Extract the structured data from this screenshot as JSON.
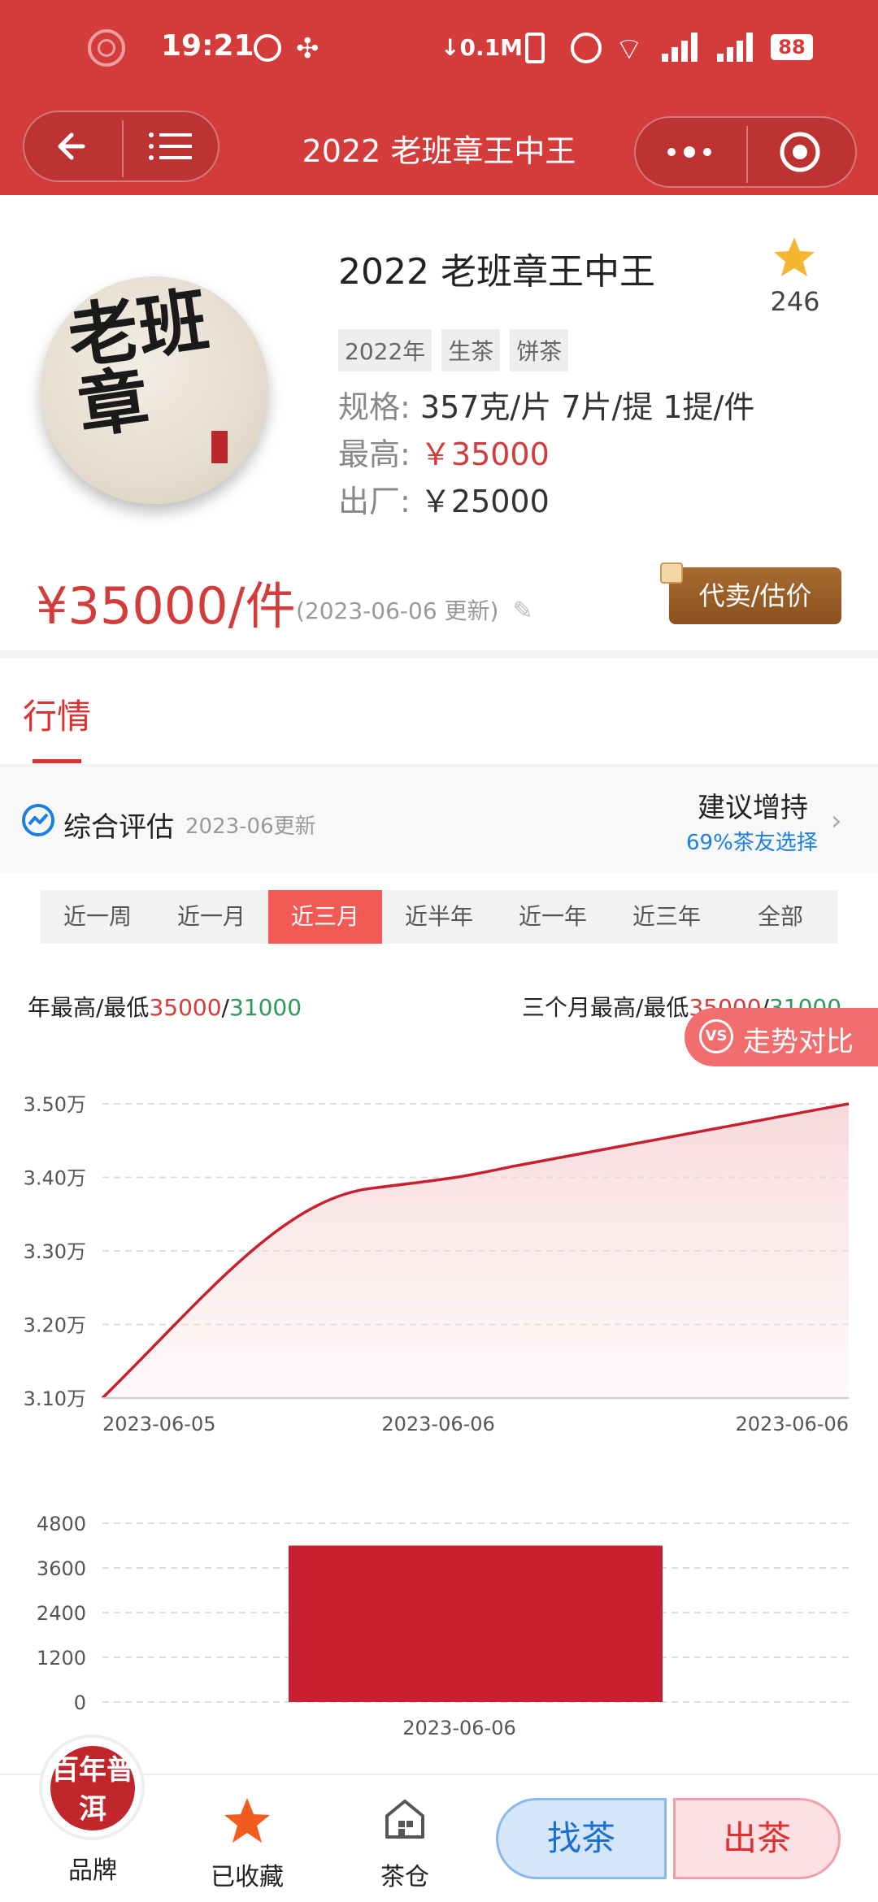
{
  "status_bar": {
    "time": "19:21",
    "net_speed": "↓0.1M",
    "battery": "88"
  },
  "header": {
    "title": "2022 老班章王中王"
  },
  "product": {
    "name": "2022 老班章王中王",
    "favorites_count": "246",
    "tags": [
      "2022年",
      "生茶",
      "饼茶"
    ],
    "spec_label": "规格:",
    "spec_value": "357克/片 7片/提 1提/件",
    "high_label": "最高:",
    "high_value": "￥35000",
    "factory_label": "出厂:",
    "factory_value": "￥25000",
    "image_text": "老班章",
    "price": "¥35000/件",
    "price_note": "(2023-06-06 更新)",
    "consign_button": "代卖/估价"
  },
  "market": {
    "tab_label": "行情",
    "eval_label": "综合评估",
    "eval_date": "2023-06更新",
    "suggest_title": "建议增持",
    "suggest_sub": "69%茶友选择",
    "ranges": [
      "近一周",
      "近一月",
      "近三月",
      "近半年",
      "近一年",
      "近三年",
      "全部"
    ],
    "active_range_index": 2,
    "year_hl_label": "年最高/最低",
    "year_high": "35000",
    "year_low": "31000",
    "q_hl_label": "三个月最高/最低",
    "q_high": "35000",
    "q_low": "31000",
    "compare_button": "走势对比",
    "vs_icon_text": "VS"
  },
  "chart_data": [
    {
      "type": "area",
      "y_tick_labels": [
        "3.50万",
        "3.40万",
        "3.30万",
        "3.20万",
        "3.10万"
      ],
      "y_ticks": [
        35000,
        34000,
        33000,
        32000,
        31000
      ],
      "ylim": [
        31000,
        35000
      ],
      "x_tick_labels": [
        "2023-06-05",
        "2023-06-06",
        "2023-06-06"
      ],
      "x": [
        0,
        0.45,
        1.0
      ],
      "y": [
        31000,
        33800,
        35000
      ],
      "color": "#c8202e",
      "grid": true
    },
    {
      "type": "bar",
      "y_tick_labels": [
        "4800",
        "3600",
        "2400",
        "1200",
        "0"
      ],
      "y_ticks": [
        4800,
        3600,
        2400,
        1200,
        0
      ],
      "ylim": [
        0,
        4800
      ],
      "categories": [
        "2023-06-06"
      ],
      "values": [
        4200
      ],
      "color": "#c8202e",
      "grid": true
    }
  ],
  "bottom_nav": {
    "brand_label": "品牌",
    "fav_label": "已收藏",
    "warehouse_label": "茶仓",
    "find_button": "找茶",
    "sell_button": "出茶",
    "logo_text": "百年普洱"
  },
  "colors": {
    "primary_red": "#d43c3c",
    "chart_red": "#c8202e",
    "green": "#2e9a5a",
    "blue": "#1a7fe0",
    "star": "#f5b731"
  }
}
